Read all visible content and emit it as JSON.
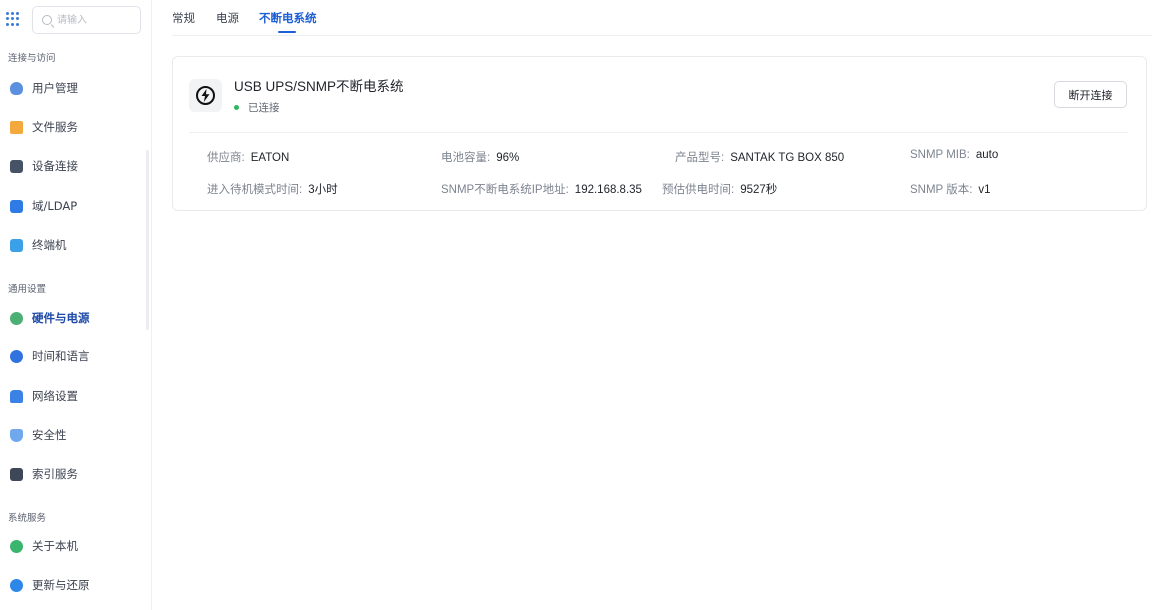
{
  "search": {
    "placeholder": "请输入"
  },
  "sidebar": {
    "sections": [
      {
        "title": "连接与访问"
      },
      {
        "title": "通用设置"
      },
      {
        "title": "系统服务"
      }
    ],
    "items": [
      {
        "label": "用户管理",
        "icon": "user-icon"
      },
      {
        "label": "文件服务",
        "icon": "folder-icon"
      },
      {
        "label": "设备连接",
        "icon": "device-icon"
      },
      {
        "label": "域/LDAP",
        "icon": "domain-icon"
      },
      {
        "label": "终端机",
        "icon": "terminal-icon"
      },
      {
        "label": "硬件与电源",
        "icon": "hardware-icon",
        "active": true
      },
      {
        "label": "时间和语言",
        "icon": "clock-icon"
      },
      {
        "label": "网络设置",
        "icon": "network-icon"
      },
      {
        "label": "安全性",
        "icon": "shield-icon"
      },
      {
        "label": "索引服务",
        "icon": "index-icon"
      },
      {
        "label": "关于本机",
        "icon": "info-icon"
      },
      {
        "label": "更新与还原",
        "icon": "update-icon"
      }
    ]
  },
  "tabs": [
    {
      "label": "常规"
    },
    {
      "label": "电源"
    },
    {
      "label": "不断电系统",
      "active": true
    }
  ],
  "ups": {
    "title": "USB UPS/SNMP不断电系统",
    "status": "已连接",
    "status_color": "#2fb55e",
    "disconnect_label": "断开连接",
    "info": [
      {
        "key": "供应商:",
        "value": "EATON"
      },
      {
        "key": "电池容量:",
        "value": "96%"
      },
      {
        "key": "产品型号:",
        "value": "SANTAK TG BOX 850"
      },
      {
        "key": "SNMP MIB:",
        "value": "auto"
      },
      {
        "key": "进入待机模式时间:",
        "value": "3小时"
      },
      {
        "key": "SNMP不断电系统IP地址:",
        "value": "192.168.8.35"
      },
      {
        "key": "预估供电时间:",
        "value": "9527秒"
      },
      {
        "key": "SNMP 版本:",
        "value": "v1"
      }
    ]
  },
  "colors": {
    "accent": "#1e5fd6",
    "active_nav": "#1e4aa8"
  }
}
